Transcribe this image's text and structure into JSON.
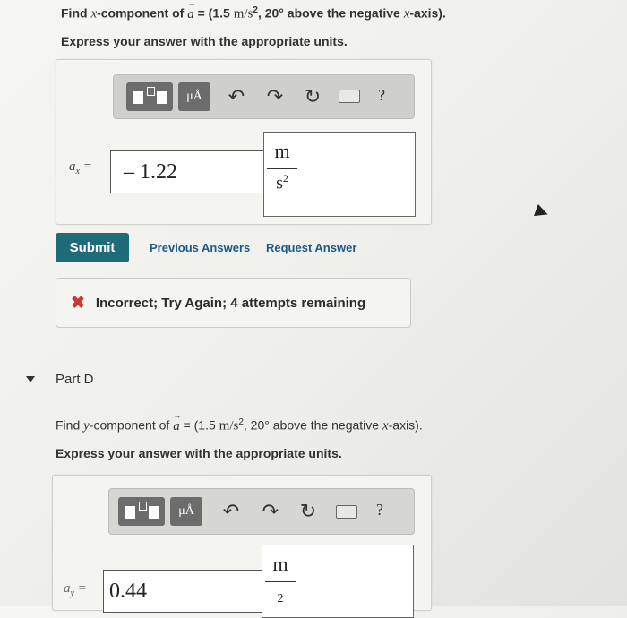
{
  "part_c": {
    "q_find": "Find ",
    "q_var": "x",
    "q_comp": "-component of ",
    "q_vec": "a",
    "q_eq": " = (1.5 ",
    "q_unit": "m/s",
    "q_exp": "2",
    "q_dir": ", 20° above the negative ",
    "q_axis": "x",
    "q_end": "-axis).",
    "subtitle": "Express your answer with the appropriate units.",
    "toolbar": {
      "mu_label": "μÅ",
      "undo_icon": "undo-icon",
      "redo_icon": "redo-icon",
      "reset_icon": "reset-icon",
      "keyboard_icon": "keyboard-icon",
      "help_label": "?"
    },
    "var_label": "a",
    "var_sub": "x",
    "equals": " =",
    "answer_value": "– 1.22",
    "unit_numerator": "m",
    "unit_denominator": "s",
    "unit_den_exp": "2",
    "submit_label": "Submit",
    "previous_answers_label": "Previous Answers",
    "request_answer_label": "Request Answer",
    "feedback_icon": "✖",
    "feedback_text": "Incorrect; Try Again; 4 attempts remaining"
  },
  "part_d": {
    "title": "Part D",
    "q_find": "Find ",
    "q_var": "y",
    "q_comp": "-component of ",
    "q_vec": "a",
    "q_eq": " = (1.5 ",
    "q_unit": "m/s",
    "q_exp": "2",
    "q_dir": ", 20° above the negative ",
    "q_axis": "x",
    "q_end": "-axis).",
    "subtitle": "Express your answer with the appropriate units.",
    "toolbar": {
      "mu_label": "μÅ",
      "help_label": "?"
    },
    "var_label": "a",
    "var_sub": "y",
    "equals": " =",
    "answer_value": "0.44",
    "unit_numerator": "m",
    "unit_denominator": "2"
  },
  "colors": {
    "submit": "#1f6b79",
    "link": "#1d5a8a",
    "error": "#d0342c"
  }
}
